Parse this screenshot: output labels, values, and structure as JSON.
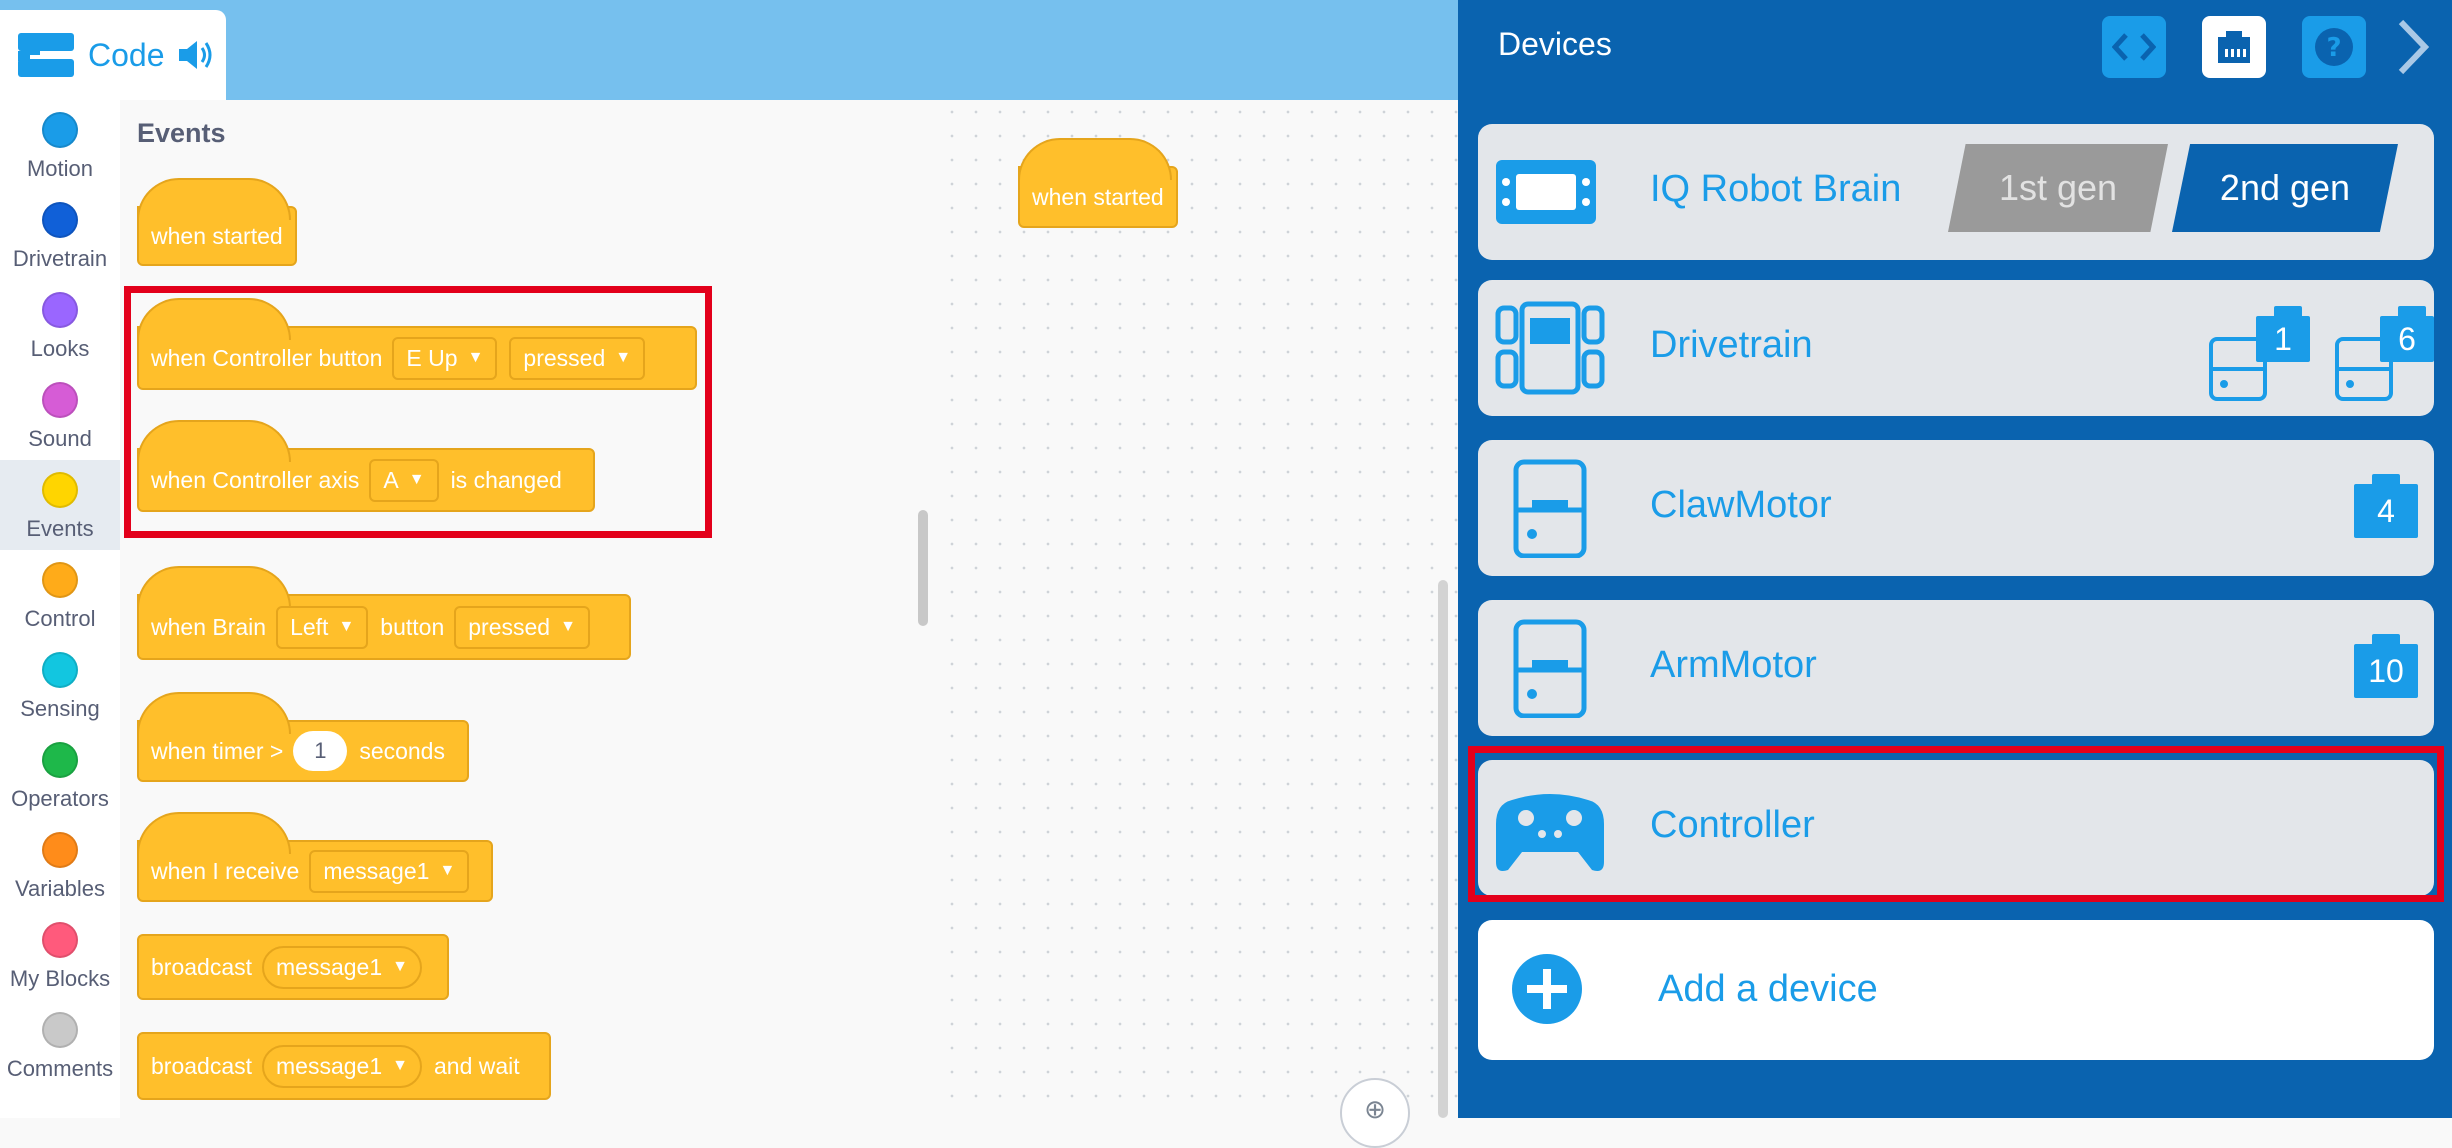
{
  "header": {
    "tab_label": "Code"
  },
  "categories": [
    {
      "name": "Motion",
      "color": "#1a9ce8"
    },
    {
      "name": "Drivetrain",
      "color": "#1060d8"
    },
    {
      "name": "Looks",
      "color": "#9a66ff"
    },
    {
      "name": "Sound",
      "color": "#d65cd6"
    },
    {
      "name": "Events",
      "color": "#ffd500"
    },
    {
      "name": "Control",
      "color": "#ffab19"
    },
    {
      "name": "Sensing",
      "color": "#12c6e0"
    },
    {
      "name": "Operators",
      "color": "#1eb84a"
    },
    {
      "name": "Variables",
      "color": "#ff8c1a"
    },
    {
      "name": "My Blocks",
      "color": "#ff5a7c"
    },
    {
      "name": "Comments",
      "color": "#c9c9c9"
    }
  ],
  "active_category": "Events",
  "palette": {
    "title": "Events",
    "when_started": "when started",
    "controller_button": {
      "text": "when Controller button",
      "button": "E Up",
      "state": "pressed"
    },
    "controller_axis": {
      "text": "when Controller axis",
      "axis": "A",
      "suffix": "is changed"
    },
    "brain_button": {
      "text": "when Brain",
      "button": "Left",
      "middle": "button",
      "state": "pressed"
    },
    "timer": {
      "text": "when timer >",
      "value": "1",
      "suffix": "seconds"
    },
    "receive": {
      "text": "when I receive",
      "message": "message1"
    },
    "broadcast": {
      "text": "broadcast",
      "message": "message1"
    },
    "broadcast_wait": {
      "text": "broadcast",
      "message": "message1",
      "suffix": "and wait"
    }
  },
  "workspace": {
    "block": "when started",
    "zoom_icon": "zoom-in-icon"
  },
  "devices": {
    "title": "Devices",
    "brain": {
      "name": "IQ Robot Brain",
      "gen1": "1st gen",
      "gen2": "2nd gen",
      "selected": "2nd gen"
    },
    "drivetrain": {
      "name": "Drivetrain",
      "ports": [
        "1",
        "6"
      ]
    },
    "claw": {
      "name": "ClawMotor",
      "port": "4"
    },
    "arm": {
      "name": "ArmMotor",
      "port": "10"
    },
    "controller": {
      "name": "Controller"
    },
    "add": {
      "label": "Add a device"
    }
  },
  "colors": {
    "accent": "#1a9ce8",
    "panel": "#0a63af",
    "block": "#ffbf2b",
    "highlight": "#e3001b"
  }
}
